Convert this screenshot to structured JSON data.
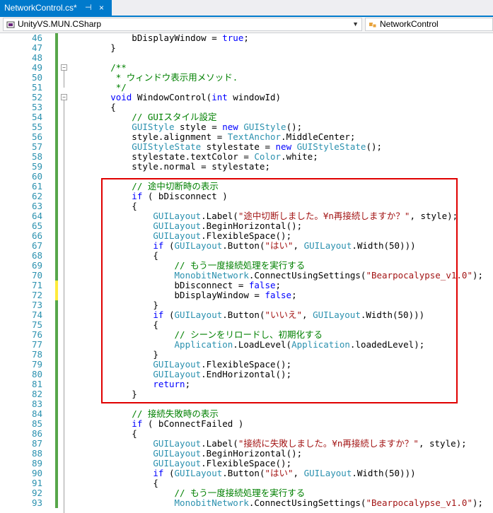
{
  "tab": {
    "title": "NetworkControl.cs*",
    "pin": "⊣",
    "close": "×"
  },
  "nav": {
    "project": "UnityVS.MUN.CSharp",
    "class": "NetworkControl"
  },
  "colors": {
    "accent": "#007acc",
    "highlight": "#e00000",
    "gutter_saved": "#57a64a",
    "gutter_changed": "#ffeb3b"
  },
  "lines": [
    {
      "n": "46",
      "parts": [
        [
          "",
          "            bDisplayWindow = "
        ],
        [
          "kw",
          "true"
        ],
        [
          "",
          ";"
        ]
      ]
    },
    {
      "n": "47",
      "parts": [
        [
          "",
          "        }"
        ]
      ]
    },
    {
      "n": "48",
      "parts": []
    },
    {
      "n": "49",
      "parts": [
        [
          "cm",
          "        /**"
        ]
      ]
    },
    {
      "n": "50",
      "parts": [
        [
          "cm",
          "         * ウィンドウ表示用メソッド."
        ]
      ]
    },
    {
      "n": "51",
      "parts": [
        [
          "cm",
          "         */"
        ]
      ]
    },
    {
      "n": "52",
      "parts": [
        [
          "kw",
          "        void"
        ],
        [
          "",
          " WindowControl("
        ],
        [
          "kw",
          "int"
        ],
        [
          "",
          " windowId)"
        ]
      ]
    },
    {
      "n": "53",
      "parts": [
        [
          "",
          "        {"
        ]
      ]
    },
    {
      "n": "54",
      "parts": [
        [
          "cm",
          "            // GUIスタイル設定"
        ]
      ]
    },
    {
      "n": "55",
      "parts": [
        [
          "ty",
          "            GUIStyle"
        ],
        [
          "",
          " style = "
        ],
        [
          "kw",
          "new"
        ],
        [
          "",
          " "
        ],
        [
          "ty",
          "GUIStyle"
        ],
        [
          "",
          "();"
        ]
      ]
    },
    {
      "n": "56",
      "parts": [
        [
          "",
          "            style.alignment = "
        ],
        [
          "ty",
          "TextAnchor"
        ],
        [
          "",
          ".MiddleCenter;"
        ]
      ]
    },
    {
      "n": "57",
      "parts": [
        [
          "ty",
          "            GUIStyleState"
        ],
        [
          "",
          " stylestate = "
        ],
        [
          "kw",
          "new"
        ],
        [
          "",
          " "
        ],
        [
          "ty",
          "GUIStyleState"
        ],
        [
          "",
          "();"
        ]
      ]
    },
    {
      "n": "58",
      "parts": [
        [
          "",
          "            stylestate.textColor = "
        ],
        [
          "ty",
          "Color"
        ],
        [
          "",
          ".white;"
        ]
      ]
    },
    {
      "n": "59",
      "parts": [
        [
          "",
          "            style.normal = stylestate;"
        ]
      ]
    },
    {
      "n": "60",
      "parts": []
    },
    {
      "n": "61",
      "parts": [
        [
          "cm",
          "            // 途中切断時の表示"
        ]
      ]
    },
    {
      "n": "62",
      "parts": [
        [
          "kw",
          "            if"
        ],
        [
          "",
          " ( bDisconnect )"
        ]
      ]
    },
    {
      "n": "63",
      "parts": [
        [
          "",
          "            {"
        ]
      ]
    },
    {
      "n": "64",
      "parts": [
        [
          "ty",
          "                GUILayout"
        ],
        [
          "",
          ".Label("
        ],
        [
          "st",
          "\"途中切断しました。¥n再接続しますか？\""
        ],
        [
          "",
          ", style);"
        ]
      ]
    },
    {
      "n": "65",
      "parts": [
        [
          "ty",
          "                GUILayout"
        ],
        [
          "",
          ".BeginHorizontal();"
        ]
      ]
    },
    {
      "n": "66",
      "parts": [
        [
          "ty",
          "                GUILayout"
        ],
        [
          "",
          ".FlexibleSpace();"
        ]
      ]
    },
    {
      "n": "67",
      "parts": [
        [
          "kw",
          "                if"
        ],
        [
          "",
          " ("
        ],
        [
          "ty",
          "GUILayout"
        ],
        [
          "",
          ".Button("
        ],
        [
          "st",
          "\"はい\""
        ],
        [
          "",
          ", "
        ],
        [
          "ty",
          "GUILayout"
        ],
        [
          "",
          ".Width(50)))"
        ]
      ]
    },
    {
      "n": "68",
      "parts": [
        [
          "",
          "                {"
        ]
      ]
    },
    {
      "n": "69",
      "parts": [
        [
          "cm",
          "                    // もう一度接続処理を実行する"
        ]
      ]
    },
    {
      "n": "70",
      "parts": [
        [
          "ty",
          "                    MonobitNetwork"
        ],
        [
          "",
          ".ConnectUsingSettings("
        ],
        [
          "st",
          "\"Bearpocalypse_v1.0\""
        ],
        [
          "",
          ");"
        ]
      ]
    },
    {
      "n": "71",
      "parts": [
        [
          "",
          "                    bDisconnect = "
        ],
        [
          "kw",
          "false"
        ],
        [
          "",
          ";"
        ]
      ]
    },
    {
      "n": "72",
      "parts": [
        [
          "",
          "                    bDisplayWindow = "
        ],
        [
          "kw",
          "false"
        ],
        [
          "",
          ";"
        ]
      ]
    },
    {
      "n": "73",
      "parts": [
        [
          "",
          "                }"
        ]
      ]
    },
    {
      "n": "74",
      "parts": [
        [
          "kw",
          "                if"
        ],
        [
          "",
          " ("
        ],
        [
          "ty",
          "GUILayout"
        ],
        [
          "",
          ".Button("
        ],
        [
          "st",
          "\"いいえ\""
        ],
        [
          "",
          ", "
        ],
        [
          "ty",
          "GUILayout"
        ],
        [
          "",
          ".Width(50)))"
        ]
      ]
    },
    {
      "n": "75",
      "parts": [
        [
          "",
          "                {"
        ]
      ]
    },
    {
      "n": "76",
      "parts": [
        [
          "cm",
          "                    // シーンをリロードし、初期化する"
        ]
      ]
    },
    {
      "n": "77",
      "parts": [
        [
          "ty",
          "                    Application"
        ],
        [
          "",
          ".LoadLevel("
        ],
        [
          "ty",
          "Application"
        ],
        [
          "",
          ".loadedLevel);"
        ]
      ]
    },
    {
      "n": "78",
      "parts": [
        [
          "",
          "                }"
        ]
      ]
    },
    {
      "n": "79",
      "parts": [
        [
          "ty",
          "                GUILayout"
        ],
        [
          "",
          ".FlexibleSpace();"
        ]
      ]
    },
    {
      "n": "80",
      "parts": [
        [
          "ty",
          "                GUILayout"
        ],
        [
          "",
          ".EndHorizontal();"
        ]
      ]
    },
    {
      "n": "81",
      "parts": [
        [
          "kw",
          "                return"
        ],
        [
          "",
          ";"
        ]
      ]
    },
    {
      "n": "82",
      "parts": [
        [
          "",
          "            }"
        ]
      ]
    },
    {
      "n": "83",
      "parts": []
    },
    {
      "n": "84",
      "parts": [
        [
          "cm",
          "            // 接続失敗時の表示"
        ]
      ]
    },
    {
      "n": "85",
      "parts": [
        [
          "kw",
          "            if"
        ],
        [
          "",
          " ( bConnectFailed )"
        ]
      ]
    },
    {
      "n": "86",
      "parts": [
        [
          "",
          "            {"
        ]
      ]
    },
    {
      "n": "87",
      "parts": [
        [
          "ty",
          "                GUILayout"
        ],
        [
          "",
          ".Label("
        ],
        [
          "st",
          "\"接続に失敗しました。¥n再接続しますか？\""
        ],
        [
          "",
          ", style);"
        ]
      ]
    },
    {
      "n": "88",
      "parts": [
        [
          "ty",
          "                GUILayout"
        ],
        [
          "",
          ".BeginHorizontal();"
        ]
      ]
    },
    {
      "n": "89",
      "parts": [
        [
          "ty",
          "                GUILayout"
        ],
        [
          "",
          ".FlexibleSpace();"
        ]
      ]
    },
    {
      "n": "90",
      "parts": [
        [
          "kw",
          "                if"
        ],
        [
          "",
          " ("
        ],
        [
          "ty",
          "GUILayout"
        ],
        [
          "",
          ".Button("
        ],
        [
          "st",
          "\"はい\""
        ],
        [
          "",
          ", "
        ],
        [
          "ty",
          "GUILayout"
        ],
        [
          "",
          ".Width(50)))"
        ]
      ]
    },
    {
      "n": "91",
      "parts": [
        [
          "",
          "                {"
        ]
      ]
    },
    {
      "n": "92",
      "parts": [
        [
          "cm",
          "                    // もう一度接続処理を実行する"
        ]
      ]
    },
    {
      "n": "93",
      "parts": [
        [
          "ty",
          "                    MonobitNetwork"
        ],
        [
          "",
          ".ConnectUsingSettings("
        ],
        [
          "st",
          "\"Bearpocalypse_v1.0\""
        ],
        [
          "",
          ");"
        ]
      ]
    }
  ],
  "changed_lines": [
    "71",
    "72"
  ],
  "fold_lines": [
    "49",
    "52"
  ]
}
